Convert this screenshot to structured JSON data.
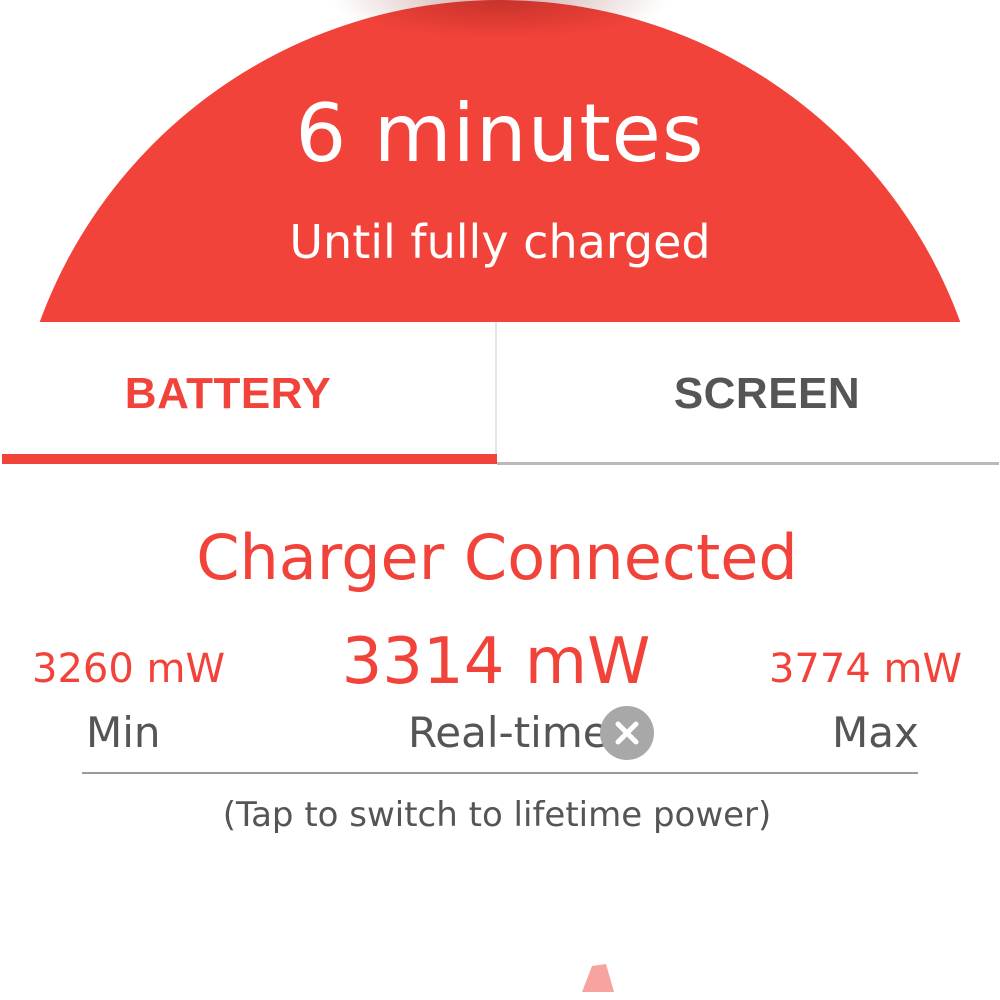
{
  "header": {
    "time_value": "6 minutes",
    "time_caption": "Until fully charged",
    "accent_color": "#f2433a"
  },
  "tabs": [
    {
      "label": "BATTERY",
      "selected": true
    },
    {
      "label": "SCREEN",
      "selected": false
    }
  ],
  "main": {
    "status_title": "Charger Connected",
    "power": {
      "min_value": "3260 mW",
      "realtime_value": "3314 mW",
      "max_value": "3774 mW",
      "min_label": "Min",
      "realtime_label": "Real-time",
      "max_label": "Max"
    },
    "reset_icon": "close-circle-icon",
    "hint": "(Tap to switch to lifetime power)"
  },
  "scroll_indicator_icon": "scroll-indicator-icon"
}
